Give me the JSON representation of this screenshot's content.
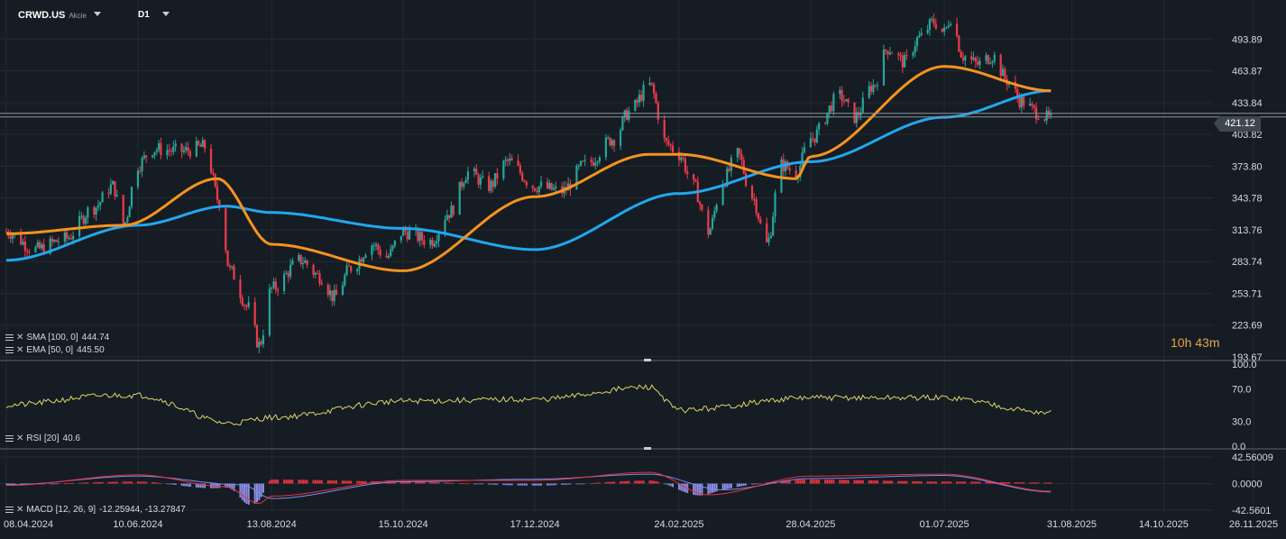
{
  "header": {
    "symbol": "CRWD.US",
    "type": "Akcie",
    "timeframe": "D1"
  },
  "countdown": {
    "hours": "10",
    "h_unit": "h",
    "minutes": "43",
    "m_unit": "m"
  },
  "indicators": {
    "sma": {
      "label": "SMA [100, 0]",
      "value": "444.74",
      "color": "#22a7f0"
    },
    "ema": {
      "label": "EMA [50, 0]",
      "value": "445.50",
      "color": "#f5931f"
    },
    "rsi": {
      "label": "RSI [20]",
      "value": "40.6",
      "color": "#d8d46a"
    },
    "macd": {
      "label": "MACD [12, 26, 9]",
      "value": "-12.25944, -13.27847"
    }
  },
  "colors": {
    "up": "#26a69a",
    "down": "#ef3b4c",
    "background": "#161c23",
    "grid": "#222a33"
  },
  "chart_data": {
    "type": "candlestick",
    "x_dates": [
      "08.04.2024",
      "10.06.2024",
      "13.08.2024",
      "15.10.2024",
      "17.12.2024",
      "24.02.2025",
      "28.04.2025",
      "01.07.2025",
      "31.08.2025",
      "14.10.2025",
      "26.11.2025"
    ],
    "price_ticks": [
      "493.89",
      "463.87",
      "433.84",
      "403.82",
      "373.80",
      "343.78",
      "313.76",
      "283.74",
      "253.71",
      "223.69",
      "193.67"
    ],
    "price_ylim": [
      193.67,
      523.91
    ],
    "current_price": "421.12",
    "rsi_ticks": [
      "100.0",
      "70.0",
      "30.0",
      "0.0"
    ],
    "macd_ticks": [
      "42.56009",
      "0.0000",
      "-42.5601"
    ],
    "close_path": [
      {
        "date": "08.04.2024",
        "close": 312
      },
      {
        "date": "22.04.2024",
        "close": 295
      },
      {
        "date": "06.05.2024",
        "close": 305
      },
      {
        "date": "20.05.2024",
        "close": 335
      },
      {
        "date": "29.05.2024",
        "close": 355
      },
      {
        "date": "03.06.2024",
        "close": 318
      },
      {
        "date": "10.06.2024",
        "close": 375
      },
      {
        "date": "17.06.2024",
        "close": 390
      },
      {
        "date": "01.07.2024",
        "close": 388
      },
      {
        "date": "12.07.2024",
        "close": 392
      },
      {
        "date": "19.07.2024",
        "close": 340
      },
      {
        "date": "24.07.2024",
        "close": 275
      },
      {
        "date": "02.08.2024",
        "close": 240
      },
      {
        "date": "07.08.2024",
        "close": 205
      },
      {
        "date": "13.08.2024",
        "close": 258
      },
      {
        "date": "27.08.2024",
        "close": 285
      },
      {
        "date": "05.09.2024",
        "close": 270
      },
      {
        "date": "12.09.2024",
        "close": 250
      },
      {
        "date": "20.09.2024",
        "close": 278
      },
      {
        "date": "30.09.2024",
        "close": 300
      },
      {
        "date": "07.10.2024",
        "close": 288
      },
      {
        "date": "15.10.2024",
        "close": 312
      },
      {
        "date": "28.10.2024",
        "close": 303
      },
      {
        "date": "06.11.2024",
        "close": 330
      },
      {
        "date": "15.11.2024",
        "close": 368
      },
      {
        "date": "25.11.2024",
        "close": 355
      },
      {
        "date": "04.12.2024",
        "close": 378
      },
      {
        "date": "17.12.2024",
        "close": 355
      },
      {
        "date": "30.12.2024",
        "close": 350
      },
      {
        "date": "10.01.2025",
        "close": 375
      },
      {
        "date": "24.01.2025",
        "close": 400
      },
      {
        "date": "31.01.2025",
        "close": 425
      },
      {
        "date": "10.02.2025",
        "close": 450
      },
      {
        "date": "18.02.2025",
        "close": 395
      },
      {
        "date": "24.02.2025",
        "close": 385
      },
      {
        "date": "03.03.2025",
        "close": 355
      },
      {
        "date": "10.03.2025",
        "close": 312
      },
      {
        "date": "17.03.2025",
        "close": 360
      },
      {
        "date": "24.03.2025",
        "close": 385
      },
      {
        "date": "31.03.2025",
        "close": 345
      },
      {
        "date": "07.04.2025",
        "close": 300
      },
      {
        "date": "14.04.2025",
        "close": 375
      },
      {
        "date": "21.04.2025",
        "close": 368
      },
      {
        "date": "28.04.2025",
        "close": 400
      },
      {
        "date": "12.05.2025",
        "close": 440
      },
      {
        "date": "19.05.2025",
        "close": 420
      },
      {
        "date": "28.05.2025",
        "close": 450
      },
      {
        "date": "04.06.2025",
        "close": 485
      },
      {
        "date": "12.06.2025",
        "close": 472
      },
      {
        "date": "19.06.2025",
        "close": 495
      },
      {
        "date": "26.06.2025",
        "close": 510
      },
      {
        "date": "01.07.2025",
        "close": 500
      },
      {
        "date": "04.07.2025",
        "close": 515
      },
      {
        "date": "10.07.2025",
        "close": 478
      },
      {
        "date": "17.07.2025",
        "close": 470
      },
      {
        "date": "24.07.2025",
        "close": 478
      },
      {
        "date": "31.07.2025",
        "close": 455
      },
      {
        "date": "07.08.2025",
        "close": 435
      },
      {
        "date": "14.08.2025",
        "close": 425
      },
      {
        "date": "21.08.2025",
        "close": 418
      }
    ],
    "sma100_path": [
      {
        "date": "08.04.2024",
        "v": 285
      },
      {
        "date": "10.06.2024",
        "v": 318
      },
      {
        "date": "22.07.2024",
        "v": 336
      },
      {
        "date": "13.08.2024",
        "v": 330
      },
      {
        "date": "15.10.2024",
        "v": 315
      },
      {
        "date": "17.12.2024",
        "v": 295
      },
      {
        "date": "24.02.2025",
        "v": 348
      },
      {
        "date": "28.04.2025",
        "v": 378
      },
      {
        "date": "01.07.2025",
        "v": 420
      },
      {
        "date": "21.08.2025",
        "v": 445
      }
    ],
    "ema50_path": [
      {
        "date": "08.04.2024",
        "v": 310
      },
      {
        "date": "03.06.2024",
        "v": 318
      },
      {
        "date": "18.07.2024",
        "v": 362
      },
      {
        "date": "13.08.2024",
        "v": 300
      },
      {
        "date": "15.10.2024",
        "v": 275
      },
      {
        "date": "17.12.2024",
        "v": 345
      },
      {
        "date": "10.02.2025",
        "v": 385
      },
      {
        "date": "24.02.2025",
        "v": 385
      },
      {
        "date": "21.04.2025",
        "v": 362
      },
      {
        "date": "28.04.2025",
        "v": 383
      },
      {
        "date": "01.07.2025",
        "v": 468
      },
      {
        "date": "21.08.2025",
        "v": 445
      }
    ],
    "rsi_path": [
      {
        "date": "08.04.2024",
        "v": 50
      },
      {
        "date": "29.05.2024",
        "v": 62
      },
      {
        "date": "10.06.2024",
        "v": 62
      },
      {
        "date": "24.07.2024",
        "v": 28
      },
      {
        "date": "13.08.2024",
        "v": 35
      },
      {
        "date": "15.10.2024",
        "v": 55
      },
      {
        "date": "17.12.2024",
        "v": 57
      },
      {
        "date": "10.02.2025",
        "v": 72
      },
      {
        "date": "24.02.2025",
        "v": 44
      },
      {
        "date": "28.04.2025",
        "v": 59
      },
      {
        "date": "01.07.2025",
        "v": 59
      },
      {
        "date": "21.08.2025",
        "v": 40.6
      }
    ],
    "macd_path": [
      {
        "date": "08.04.2024",
        "v": -3
      },
      {
        "date": "10.06.2024",
        "v": 14
      },
      {
        "date": "22.07.2024",
        "v": -5
      },
      {
        "date": "07.08.2024",
        "v": -32
      },
      {
        "date": "13.08.2024",
        "v": -20
      },
      {
        "date": "15.10.2024",
        "v": 5
      },
      {
        "date": "17.12.2024",
        "v": 5
      },
      {
        "date": "10.02.2025",
        "v": 18
      },
      {
        "date": "10.03.2025",
        "v": -18
      },
      {
        "date": "28.04.2025",
        "v": 12
      },
      {
        "date": "01.07.2025",
        "v": 15
      },
      {
        "date": "21.08.2025",
        "v": -12.25944
      }
    ],
    "signal_path": [
      {
        "date": "08.04.2024",
        "v": -2
      },
      {
        "date": "10.06.2024",
        "v": 12
      },
      {
        "date": "30.07.2024",
        "v": -2
      },
      {
        "date": "13.08.2024",
        "v": -24
      },
      {
        "date": "15.10.2024",
        "v": 3
      },
      {
        "date": "17.12.2024",
        "v": 7
      },
      {
        "date": "10.02.2025",
        "v": 15
      },
      {
        "date": "17.03.2025",
        "v": -10
      },
      {
        "date": "28.04.2025",
        "v": 8
      },
      {
        "date": "01.07.2025",
        "v": 13
      },
      {
        "date": "21.08.2025",
        "v": -13.27847
      }
    ]
  }
}
